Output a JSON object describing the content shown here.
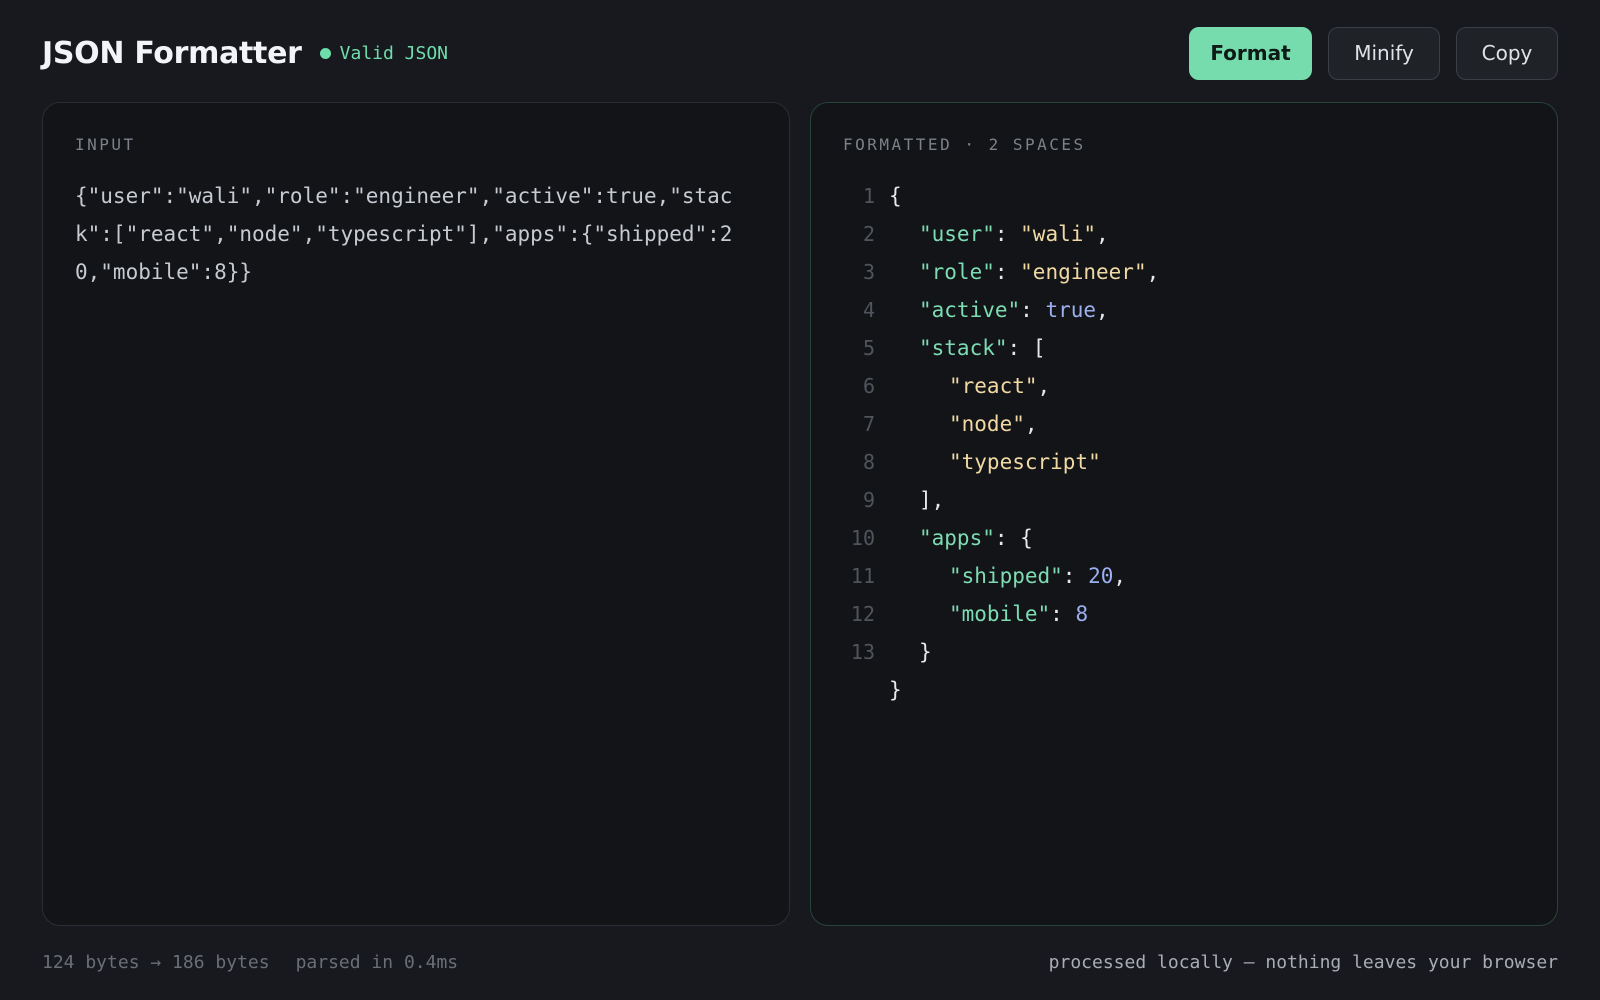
{
  "header": {
    "title": "JSON Formatter",
    "status_text": "Valid JSON",
    "status_color": "#6fdcab"
  },
  "toolbar": {
    "format_label": "Format",
    "minify_label": "Minify",
    "copy_label": "Copy"
  },
  "input_panel": {
    "label": "INPUT",
    "value": "{\"user\":\"wali\",\"role\":\"engineer\",\"active\":true,\"stack\":[\"react\",\"node\",\"typescript\"],\"apps\":{\"shipped\":20,\"mobile\":8}}"
  },
  "output_panel": {
    "label": "FORMATTED · 2 SPACES",
    "line_numbers": [
      "1",
      "2",
      "3",
      "4",
      "5",
      "6",
      "7",
      "8",
      "9",
      "10",
      "11",
      "12",
      "13"
    ],
    "lines": {
      "l1": "{",
      "l2_key": "\"user\"",
      "l2_val": "\"wali\"",
      "l3_key": "\"role\"",
      "l3_val": "\"engineer\"",
      "l4_key": "\"active\"",
      "l4_val": "true",
      "l5_key": "\"stack\"",
      "l5_open": "[",
      "l6_val": "\"react\"",
      "l7_val": "\"node\"",
      "l8_val": "\"typescript\"",
      "l9_close": "],",
      "l10_key": "\"apps\"",
      "l10_open": "{",
      "l11_key": "\"shipped\"",
      "l11_val": "20",
      "l12_key": "\"mobile\"",
      "l12_val": "8",
      "l13_close": "}",
      "l14_close": "}"
    }
  },
  "footer": {
    "size_info": "124 bytes → 186 bytes",
    "parse_time": "parsed in 0.4ms",
    "privacy_note": "processed locally — nothing leaves your browser"
  },
  "colors": {
    "accent": "#76dcad",
    "key": "#7ddcb2",
    "string": "#f1d9a4",
    "number": "#9cb0ef",
    "background": "#17191e"
  }
}
